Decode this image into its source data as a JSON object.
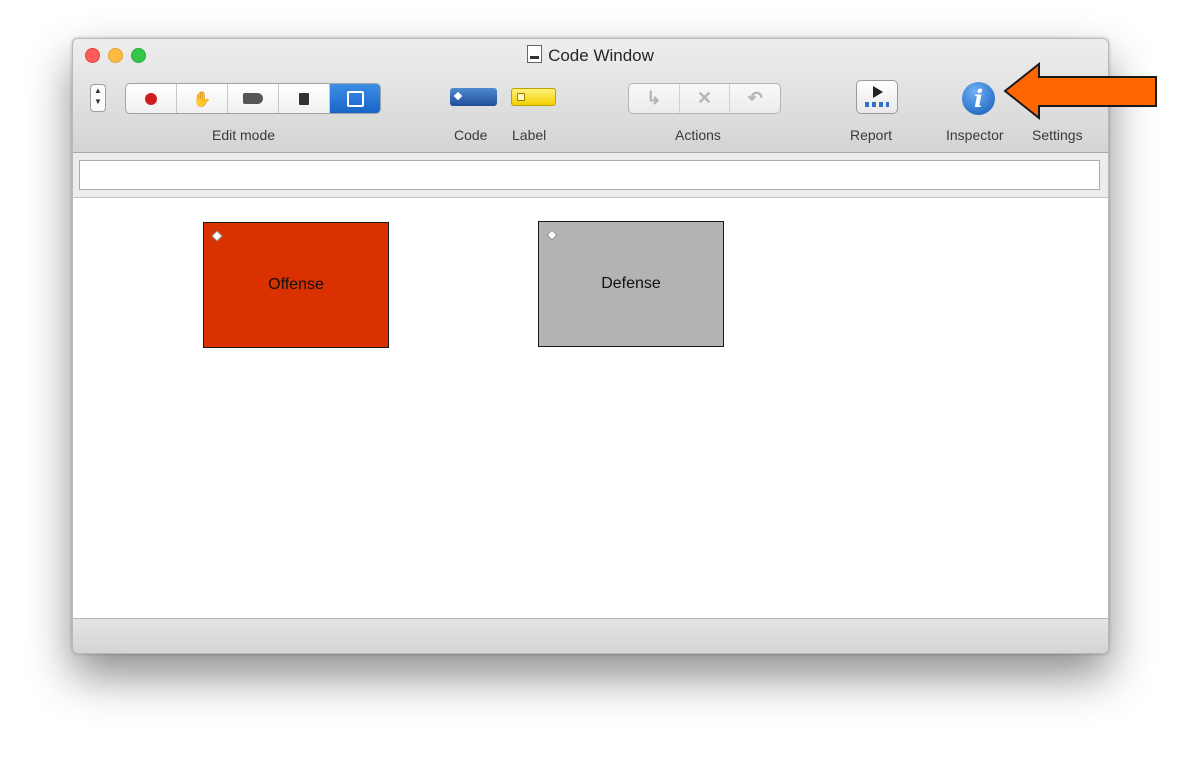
{
  "window": {
    "title": "Code Window"
  },
  "toolbar": {
    "edit_mode_label": "Edit mode",
    "edit_mode_buttons": [
      "record-dot-icon",
      "hand-pointer-icon",
      "tag-icon",
      "page-icon",
      "edit-pencil-icon"
    ],
    "edit_mode_selected": "edit-pencil-icon",
    "code_label": "Code",
    "label_label": "Label",
    "actions_label": "Actions",
    "actions_buttons": [
      "↳",
      "✕",
      "↶"
    ],
    "report_label": "Report",
    "inspector_label": "Inspector",
    "settings_label": "Settings",
    "info_glyph": "i"
  },
  "search": {
    "value": "",
    "placeholder": ""
  },
  "canvas": {
    "boxes": [
      {
        "label": "Offense",
        "color": "#da3100"
      },
      {
        "label": "Defense",
        "color": "#b3b3b3"
      }
    ]
  },
  "annotation": {
    "arrow_color": "#ff6600"
  }
}
